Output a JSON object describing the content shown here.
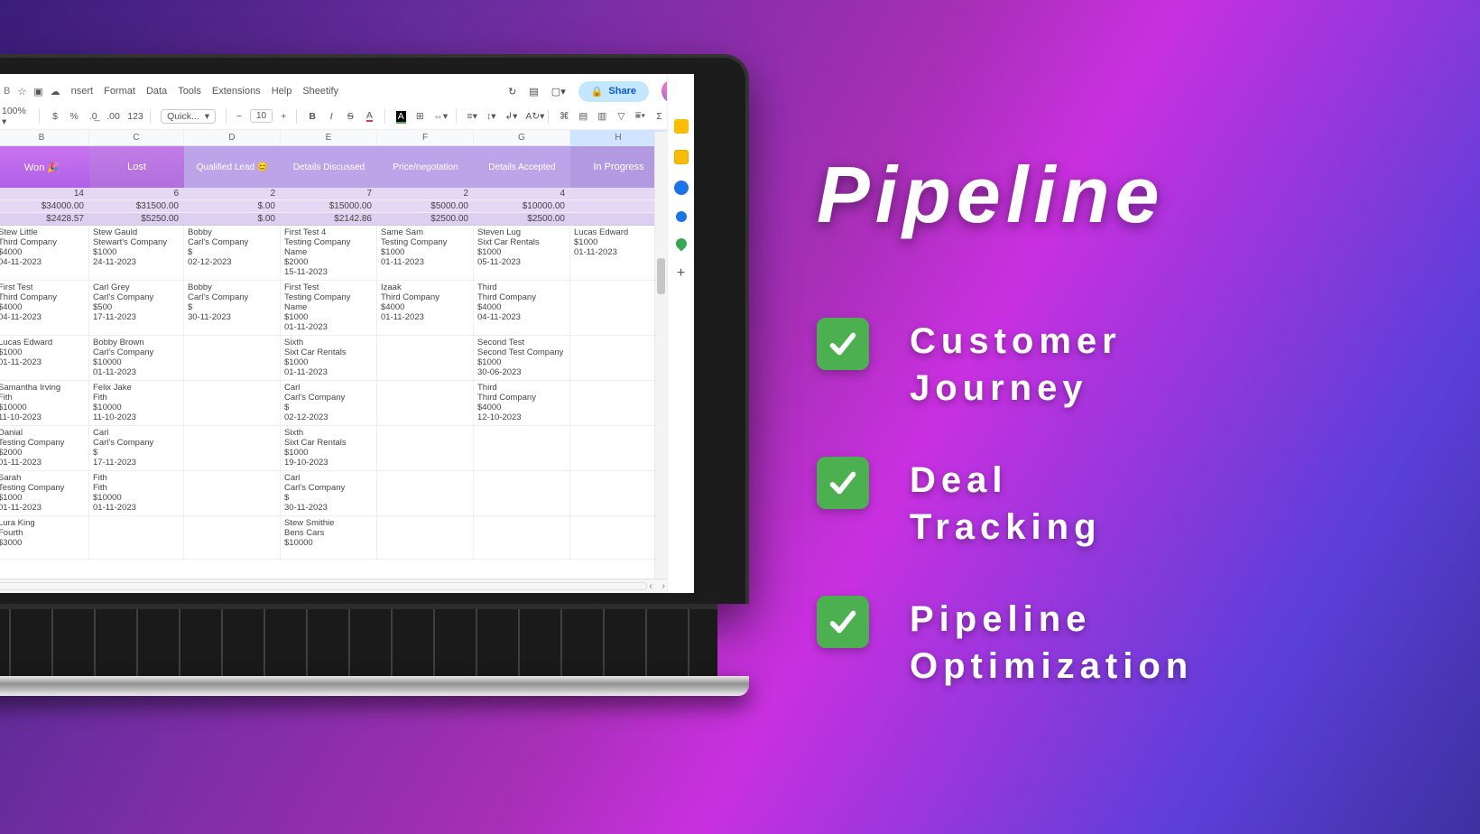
{
  "promo": {
    "title": "Pipeline",
    "items": [
      {
        "line1": "Customer",
        "line2": "Journey"
      },
      {
        "line1": "Deal",
        "line2": "Tracking"
      },
      {
        "line1": "Pipeline",
        "line2": "Optimization"
      }
    ]
  },
  "menus": [
    "nsert",
    "Format",
    "Data",
    "Tools",
    "Extensions",
    "Help",
    "Sheetify"
  ],
  "zoom": "100%",
  "font_name": "Quick...",
  "font_size": "10",
  "share_label": "Share",
  "column_letters": [
    "B",
    "C",
    "D",
    "E",
    "F",
    "G",
    "H"
  ],
  "stage_headers": [
    "Won 🎉",
    "Lost",
    "Qualified Lead 😊",
    "Details Discussed",
    "Price/negotation",
    "Details Accepted",
    "In Progress"
  ],
  "summary": {
    "counts": [
      "14",
      "6",
      "2",
      "7",
      "2",
      "4",
      ""
    ],
    "totals": [
      "$34000.00",
      "$31500.00",
      "$.00",
      "$15000.00",
      "$5000.00",
      "$10000.00",
      "$"
    ],
    "avgs": [
      "$2428.57",
      "$5250.00",
      "$.00",
      "$2142.86",
      "$2500.00",
      "$2500.00",
      ""
    ]
  },
  "cards": [
    [
      {
        "n": "Stew Little",
        "c": "Third Company",
        "a": "$4000",
        "d": "04-11-2023"
      },
      {
        "n": "Stew Gauld",
        "c": "Stewart's Company",
        "a": "$1000",
        "d": "24-11-2023"
      },
      {
        "n": "Bobby",
        "c": "Carl's Company",
        "a": "$",
        "d": "02-12-2023"
      },
      {
        "n": "First Test 4",
        "c": "Testing Company Name",
        "a": "$2000",
        "d": "15-11-2023"
      },
      {
        "n": "Same Sam",
        "c": "Testing Company",
        "a": "$1000",
        "d": "01-11-2023"
      },
      {
        "n": "Steven Lug",
        "c": "Sixt Car Rentals",
        "a": "$1000",
        "d": "05-11-2023"
      },
      {
        "n": "Lucas Edward",
        "c": "",
        "a": "$1000",
        "d": "01-11-2023"
      }
    ],
    [
      {
        "n": "First Test",
        "c": "Third Company",
        "a": "$4000",
        "d": "04-11-2023"
      },
      {
        "n": "Carl Grey",
        "c": "Carl's Company",
        "a": "$500",
        "d": "17-11-2023"
      },
      {
        "n": "Bobby",
        "c": "Carl's Company",
        "a": "$",
        "d": "30-11-2023"
      },
      {
        "n": "First Test",
        "c": "Testing Company Name",
        "a": "$1000",
        "d": "01-11-2023"
      },
      {
        "n": "Izaak",
        "c": "Third Company",
        "a": "$4000",
        "d": "01-11-2023"
      },
      {
        "n": "Third",
        "c": "Third Company",
        "a": "$4000",
        "d": "04-11-2023"
      },
      {
        "empty": true
      }
    ],
    [
      {
        "n": "Lucas Edward",
        "c": "",
        "a": "$1000",
        "d": "01-11-2023"
      },
      {
        "n": "Bobby Brown",
        "c": "Carl's Company",
        "a": "$10000",
        "d": "01-11-2023"
      },
      {
        "empty": true
      },
      {
        "n": "Sixth",
        "c": "Sixt Car Rentals",
        "a": "$1000",
        "d": "01-11-2023"
      },
      {
        "empty": true
      },
      {
        "n": "Second Test",
        "c": "Second Test Company",
        "a": "$1000",
        "d": "30-06-2023"
      },
      {
        "empty": true
      }
    ],
    [
      {
        "n": "Samantha Irving",
        "c": "Fith",
        "a": "$10000",
        "d": "11-10-2023"
      },
      {
        "n": "Felix Jake",
        "c": "Fith",
        "a": "$10000",
        "d": "11-10-2023"
      },
      {
        "empty": true
      },
      {
        "n": "Carl",
        "c": "Carl's Company",
        "a": "$",
        "d": "02-12-2023"
      },
      {
        "empty": true
      },
      {
        "n": "Third",
        "c": "Third Company",
        "a": "$4000",
        "d": "12-10-2023"
      },
      {
        "empty": true
      }
    ],
    [
      {
        "n": "Danial",
        "c": "Testing Company",
        "a": "$2000",
        "d": "01-11-2023"
      },
      {
        "n": "Carl",
        "c": "Carl's Company",
        "a": "$",
        "d": "17-11-2023"
      },
      {
        "empty": true
      },
      {
        "n": "Sixth",
        "c": "Sixt Car Rentals",
        "a": "$1000",
        "d": "19-10-2023"
      },
      {
        "empty": true
      },
      {
        "empty": true
      },
      {
        "empty": true
      }
    ],
    [
      {
        "n": "Sarah",
        "c": "Testing Company",
        "a": "$1000",
        "d": "01-11-2023"
      },
      {
        "n": "Fith",
        "c": "Fith",
        "a": "$10000",
        "d": "01-11-2023"
      },
      {
        "empty": true
      },
      {
        "n": "Carl",
        "c": "Carl's Company",
        "a": "$",
        "d": "30-11-2023"
      },
      {
        "empty": true
      },
      {
        "empty": true
      },
      {
        "empty": true
      }
    ],
    [
      {
        "n": "Lura King",
        "c": "Fourth",
        "a": "$3000",
        "d": ""
      },
      {
        "empty": true
      },
      {
        "empty": true
      },
      {
        "n": "Stew Smithie",
        "c": "Bens Cars",
        "a": "$10000",
        "d": ""
      },
      {
        "empty": true
      },
      {
        "empty": true
      },
      {
        "empty": true
      }
    ]
  ]
}
